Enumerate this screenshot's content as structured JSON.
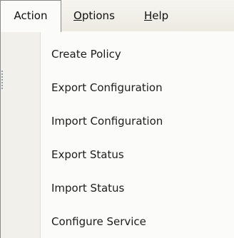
{
  "menubar": {
    "menus": [
      {
        "label": "Action",
        "open": true
      },
      {
        "prefix": "",
        "mnemonic": "O",
        "rest": "ptions"
      },
      {
        "prefix": "",
        "mnemonic": "H",
        "rest": "elp"
      }
    ]
  },
  "dropdown": {
    "items": [
      {
        "label": "Create Policy"
      },
      {
        "label": "Export Configuration"
      },
      {
        "label": "Import Configuration"
      },
      {
        "label": "Export Status"
      },
      {
        "label": "Import Status"
      },
      {
        "label": "Configure Service"
      }
    ]
  }
}
